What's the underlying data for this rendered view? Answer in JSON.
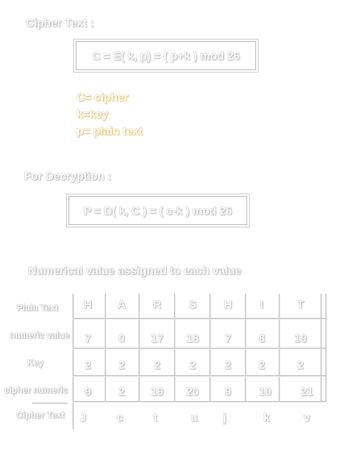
{
  "cipher_heading": "Cipher Text :",
  "encryption_formula": "C = E( k, p) = ( p+k ) mod 26",
  "variables": [
    "C= cipher",
    "k=key",
    "p= plain text"
  ],
  "decryption_heading": "For Decryption :",
  "decryption_formula": "P = D( k, C ) = ( c-k ) mod 26",
  "table_heading": "Numerical value assigned to each value",
  "table": {
    "row_labels": [
      "Plain Text",
      "numeric value",
      "Key",
      "cipher numeric",
      "Cipher Text"
    ],
    "rows": [
      [
        "H",
        "A",
        "R",
        "S",
        "H",
        "I",
        "T"
      ],
      [
        "7",
        "0",
        "17",
        "18",
        "7",
        "8",
        "19"
      ],
      [
        "2",
        "2",
        "2",
        "2",
        "2",
        "2",
        "2"
      ],
      [
        "9",
        "2",
        "19",
        "20",
        "9",
        "10",
        "21"
      ],
      [
        "J",
        "c",
        "t",
        "u",
        "j",
        "k",
        "v"
      ]
    ]
  },
  "colors": {
    "emboss_gray": "#9a9a9a",
    "emboss_gold": "#c9a94a"
  }
}
